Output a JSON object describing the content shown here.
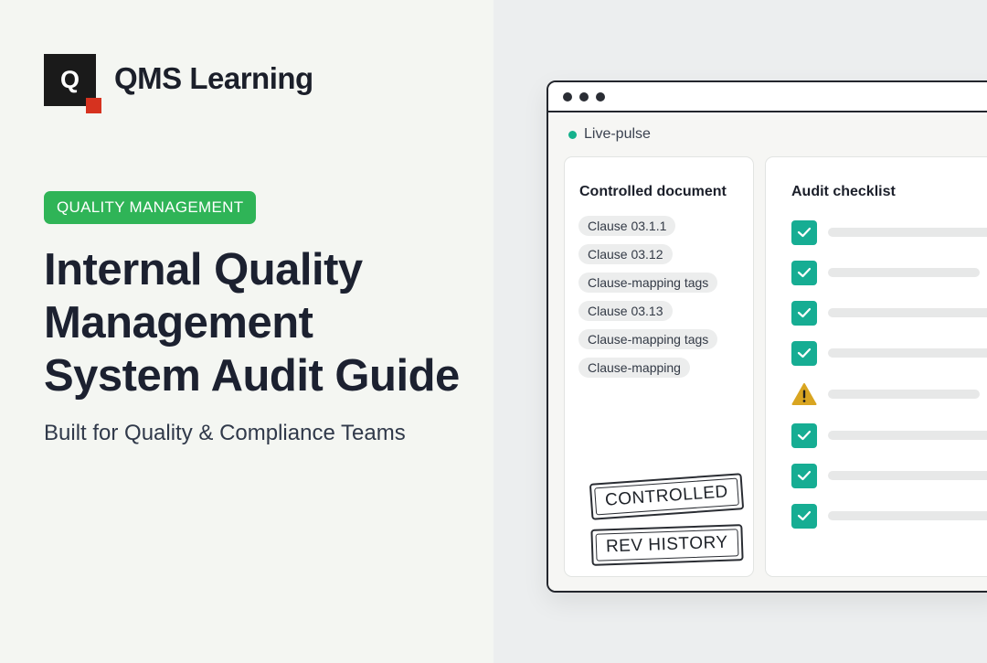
{
  "brand": {
    "logo_letter": "Q",
    "name": "QMS Learning",
    "accent_color": "#d6321f"
  },
  "hero": {
    "category": "QUALITY MANAGEMENT",
    "category_color": "#2fb457",
    "headline_lines": [
      "Internal Quality",
      "Management",
      "System Audit Guide"
    ],
    "subtitle": "Built for Quality & Compliance Teams"
  },
  "window": {
    "status_label": "Live-pulse",
    "status_color": "#15b18c",
    "document_card": {
      "title": "Controlled document",
      "tags": [
        "Clause 03.1.1",
        "Clause 03.12",
        "Clause-mapping tags",
        "Clause 03.13",
        "Clause-mapping tags",
        "Clause-mapping"
      ],
      "stamps": [
        "CONTROLLED",
        "REV HISTORY"
      ]
    },
    "checklist_card": {
      "title": "Audit checklist",
      "items": [
        {
          "status": "checked",
          "icon": "check-icon"
        },
        {
          "status": "checked",
          "icon": "check-icon"
        },
        {
          "status": "checked",
          "icon": "check-icon"
        },
        {
          "status": "checked",
          "icon": "check-icon"
        },
        {
          "status": "warning",
          "icon": "warning-icon"
        },
        {
          "status": "checked",
          "icon": "check-icon"
        },
        {
          "status": "checked",
          "icon": "check-icon"
        },
        {
          "status": "checked",
          "icon": "check-icon"
        }
      ],
      "check_color": "#16ad93",
      "warning_color": "#d9a521"
    }
  }
}
